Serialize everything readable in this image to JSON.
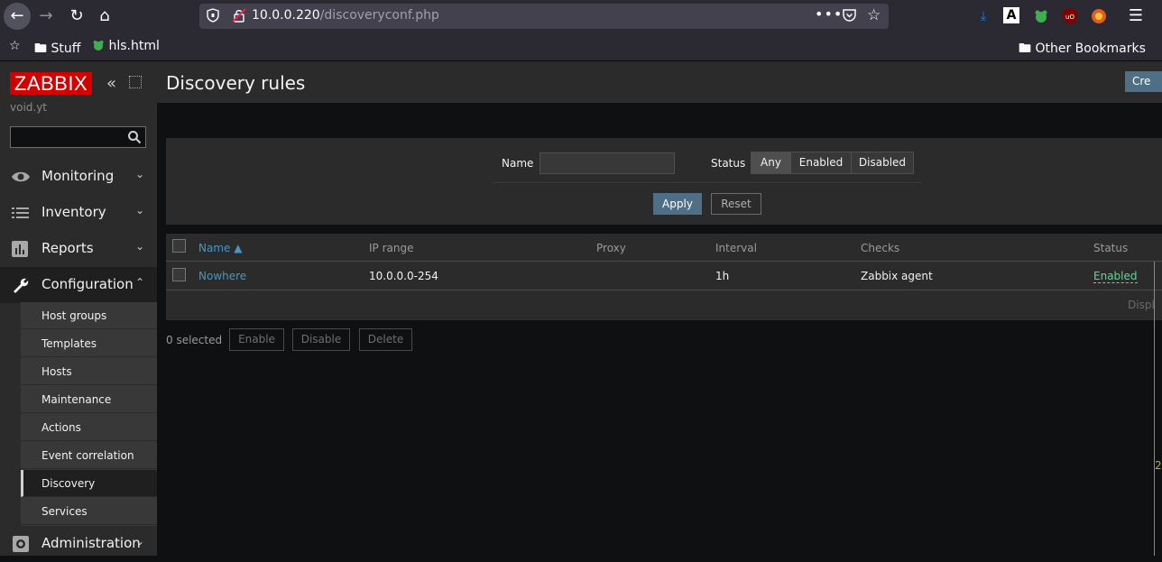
{
  "browser": {
    "url_host": "10.0.0.220",
    "url_path": "/discoveryconf.php",
    "bookmarks": [
      {
        "label": "Stuff"
      },
      {
        "label": "hls.html"
      }
    ],
    "other_bookmarks": "Other Bookmarks",
    "icons": [
      "back-arrow-icon",
      "forward-arrow-icon",
      "reload-icon",
      "home-icon",
      "shield-icon",
      "insecure-lock-icon",
      "more-icon",
      "pocket-icon",
      "star-icon",
      "download-icon",
      "font-a-icon",
      "frog-icon",
      "ublock-icon",
      "extension-icon",
      "hamburger-menu-icon"
    ]
  },
  "sidebar": {
    "logo": "ZABBIX",
    "server": "void.yt",
    "menu": [
      {
        "label": "Monitoring",
        "icon": "eye-icon"
      },
      {
        "label": "Inventory",
        "icon": "list-icon"
      },
      {
        "label": "Reports",
        "icon": "bar-chart-icon"
      },
      {
        "label": "Configuration",
        "icon": "wrench-icon"
      },
      {
        "label": "Administration",
        "icon": "gear-icon"
      }
    ],
    "submenu": [
      {
        "label": "Host groups"
      },
      {
        "label": "Templates"
      },
      {
        "label": "Hosts"
      },
      {
        "label": "Maintenance"
      },
      {
        "label": "Actions"
      },
      {
        "label": "Event correlation"
      },
      {
        "label": "Discovery"
      },
      {
        "label": "Services"
      }
    ],
    "active_submenu": "Discovery"
  },
  "page": {
    "title": "Discovery rules",
    "create_button": "Cre"
  },
  "filter": {
    "name_label": "Name",
    "name_value": "",
    "status_label": "Status",
    "status_options": [
      "Any",
      "Enabled",
      "Disabled"
    ],
    "status_selected": "Any",
    "apply": "Apply",
    "reset": "Reset"
  },
  "table": {
    "columns": [
      "Name ▲",
      "IP range",
      "Proxy",
      "Interval",
      "Checks",
      "Status"
    ],
    "rows": [
      {
        "name": "Nowhere",
        "ip_range": "10.0.0.0-254",
        "proxy": "",
        "interval": "1h",
        "checks": "Zabbix agent",
        "status": "Enabled"
      }
    ],
    "paging": "Displ"
  },
  "actions": {
    "selected": "0 selected",
    "enable": "Enable",
    "disable": "Disable",
    "delete": "Delete"
  },
  "edge_number": "2",
  "colors": {
    "link": "#4796c4",
    "enabled": "#59db8f",
    "accent": "#4f6f87",
    "logo": "#d40000"
  }
}
